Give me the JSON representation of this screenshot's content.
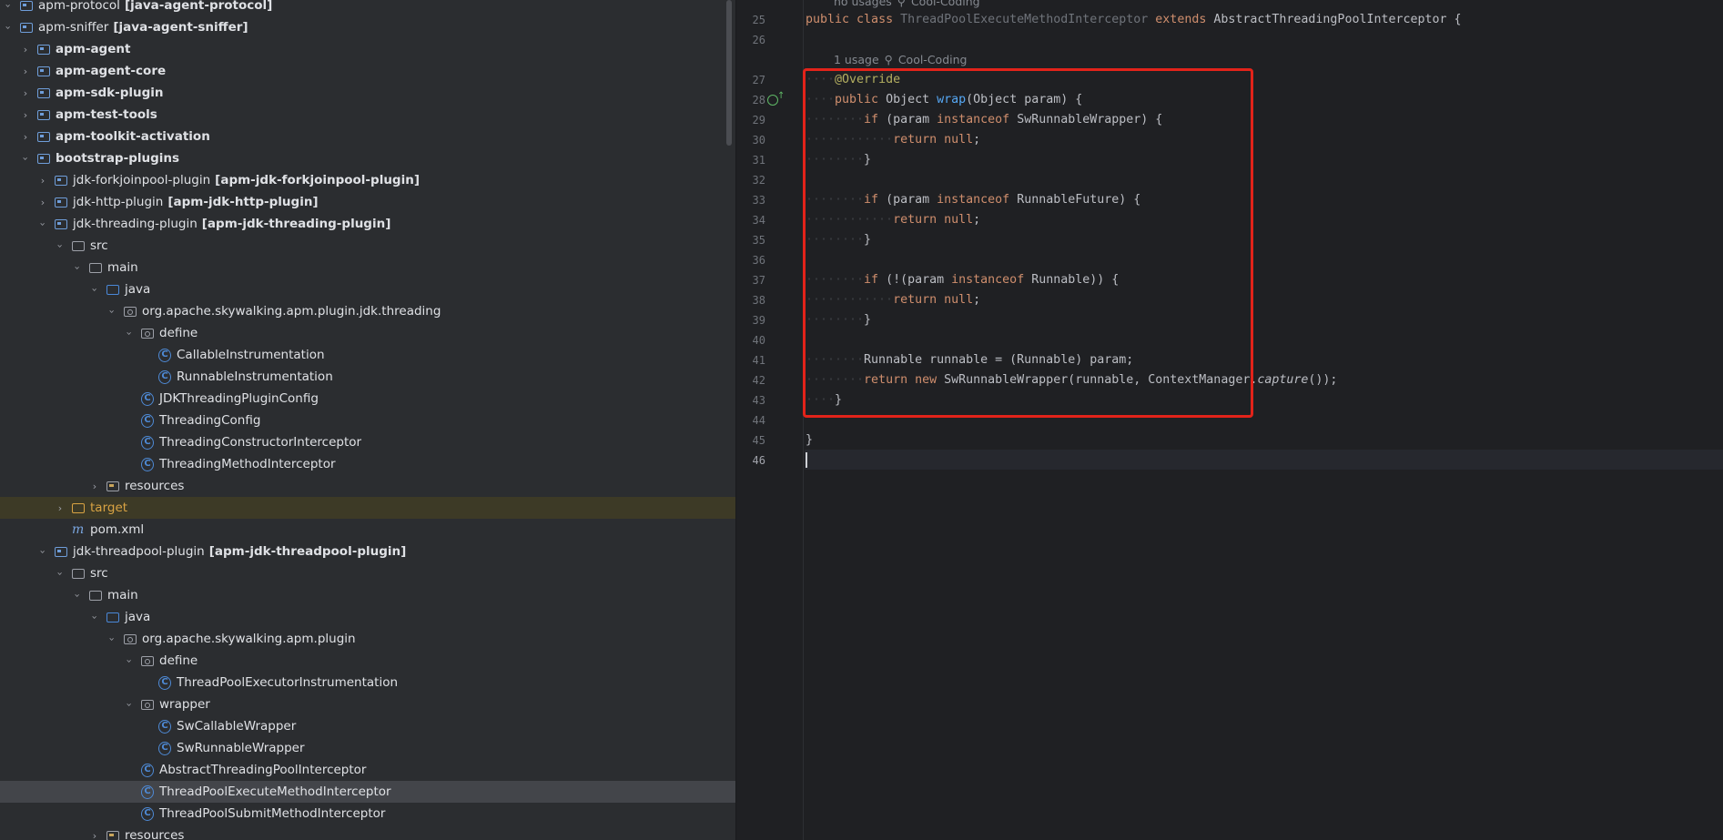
{
  "project_tree": {
    "items": [
      {
        "depth": 0,
        "chev": "open",
        "icon": "module",
        "label": "apm-protocol",
        "tag": "[java-agent-protocol]",
        "bold": false
      },
      {
        "depth": 0,
        "chev": "open",
        "icon": "module",
        "label": "apm-sniffer",
        "tag": "[java-agent-sniffer]",
        "bold": false
      },
      {
        "depth": 1,
        "chev": "closed",
        "icon": "module",
        "label": "apm-agent",
        "tag": "",
        "bold": true
      },
      {
        "depth": 1,
        "chev": "closed",
        "icon": "module",
        "label": "apm-agent-core",
        "tag": "",
        "bold": true
      },
      {
        "depth": 1,
        "chev": "closed",
        "icon": "module",
        "label": "apm-sdk-plugin",
        "tag": "",
        "bold": true
      },
      {
        "depth": 1,
        "chev": "closed",
        "icon": "module",
        "label": "apm-test-tools",
        "tag": "",
        "bold": true
      },
      {
        "depth": 1,
        "chev": "closed",
        "icon": "module",
        "label": "apm-toolkit-activation",
        "tag": "",
        "bold": true
      },
      {
        "depth": 1,
        "chev": "open",
        "icon": "module",
        "label": "bootstrap-plugins",
        "tag": "",
        "bold": true
      },
      {
        "depth": 2,
        "chev": "closed",
        "icon": "module",
        "label": "jdk-forkjoinpool-plugin",
        "tag": "[apm-jdk-forkjoinpool-plugin]",
        "bold": false
      },
      {
        "depth": 2,
        "chev": "closed",
        "icon": "module",
        "label": "jdk-http-plugin",
        "tag": "[apm-jdk-http-plugin]",
        "bold": false
      },
      {
        "depth": 2,
        "chev": "open",
        "icon": "module",
        "label": "jdk-threading-plugin",
        "tag": "[apm-jdk-threading-plugin]",
        "bold": false
      },
      {
        "depth": 3,
        "chev": "open",
        "icon": "folder",
        "label": "src",
        "tag": "",
        "bold": false
      },
      {
        "depth": 4,
        "chev": "open",
        "icon": "folder",
        "label": "main",
        "tag": "",
        "bold": false
      },
      {
        "depth": 5,
        "chev": "open",
        "icon": "src",
        "label": "java",
        "tag": "",
        "bold": false
      },
      {
        "depth": 6,
        "chev": "open",
        "icon": "pkg",
        "label": "org.apache.skywalking.apm.plugin.jdk.threading",
        "tag": "",
        "bold": false
      },
      {
        "depth": 7,
        "chev": "open",
        "icon": "pkg",
        "label": "define",
        "tag": "",
        "bold": false
      },
      {
        "depth": 8,
        "chev": "none",
        "icon": "cls",
        "label": "CallableInstrumentation",
        "tag": "",
        "bold": false
      },
      {
        "depth": 8,
        "chev": "none",
        "icon": "cls",
        "label": "RunnableInstrumentation",
        "tag": "",
        "bold": false
      },
      {
        "depth": 7,
        "chev": "none",
        "icon": "cls",
        "label": "JDKThreadingPluginConfig",
        "tag": "",
        "bold": false
      },
      {
        "depth": 7,
        "chev": "none",
        "icon": "cls",
        "label": "ThreadingConfig",
        "tag": "",
        "bold": false
      },
      {
        "depth": 7,
        "chev": "none",
        "icon": "cls",
        "label": "ThreadingConstructorInterceptor",
        "tag": "",
        "bold": false
      },
      {
        "depth": 7,
        "chev": "none",
        "icon": "cls",
        "label": "ThreadingMethodInterceptor",
        "tag": "",
        "bold": false
      },
      {
        "depth": 5,
        "chev": "closed",
        "icon": "res",
        "label": "resources",
        "tag": "",
        "bold": false
      },
      {
        "depth": 3,
        "chev": "closed",
        "icon": "target",
        "label": "target",
        "tag": "",
        "bold": false,
        "highlight": "target"
      },
      {
        "depth": 3,
        "chev": "none",
        "icon": "mvn",
        "label": "pom.xml",
        "tag": "",
        "bold": false
      },
      {
        "depth": 2,
        "chev": "open",
        "icon": "module",
        "label": "jdk-threadpool-plugin",
        "tag": "[apm-jdk-threadpool-plugin]",
        "bold": false
      },
      {
        "depth": 3,
        "chev": "open",
        "icon": "folder",
        "label": "src",
        "tag": "",
        "bold": false
      },
      {
        "depth": 4,
        "chev": "open",
        "icon": "folder",
        "label": "main",
        "tag": "",
        "bold": false
      },
      {
        "depth": 5,
        "chev": "open",
        "icon": "src",
        "label": "java",
        "tag": "",
        "bold": false
      },
      {
        "depth": 6,
        "chev": "open",
        "icon": "pkg",
        "label": "org.apache.skywalking.apm.plugin",
        "tag": "",
        "bold": false
      },
      {
        "depth": 7,
        "chev": "open",
        "icon": "pkg",
        "label": "define",
        "tag": "",
        "bold": false
      },
      {
        "depth": 8,
        "chev": "none",
        "icon": "cls",
        "label": "ThreadPoolExecutorInstrumentation",
        "tag": "",
        "bold": false
      },
      {
        "depth": 7,
        "chev": "open",
        "icon": "pkg",
        "label": "wrapper",
        "tag": "",
        "bold": false
      },
      {
        "depth": 8,
        "chev": "none",
        "icon": "cls",
        "label": "SwCallableWrapper",
        "tag": "",
        "bold": false
      },
      {
        "depth": 8,
        "chev": "none",
        "icon": "cls",
        "label": "SwRunnableWrapper",
        "tag": "",
        "bold": false
      },
      {
        "depth": 7,
        "chev": "none",
        "icon": "cls",
        "label": "AbstractThreadingPoolInterceptor",
        "tag": "",
        "bold": false
      },
      {
        "depth": 7,
        "chev": "none",
        "icon": "cls",
        "label": "ThreadPoolExecuteMethodInterceptor",
        "tag": "",
        "bold": false,
        "highlight": "selected"
      },
      {
        "depth": 7,
        "chev": "none",
        "icon": "cls",
        "label": "ThreadPoolSubmitMethodInterceptor",
        "tag": "",
        "bold": false
      },
      {
        "depth": 5,
        "chev": "closed",
        "icon": "res",
        "label": "resources",
        "tag": "",
        "bold": false
      }
    ]
  },
  "editor": {
    "hints": [
      {
        "usage": "no usages",
        "author": "Cool-Coding"
      },
      {
        "usage": "1 usage",
        "author": "Cool-Coding"
      }
    ],
    "lines": [
      {
        "n": "25",
        "segs": [
          [
            "kw",
            "public "
          ],
          [
            "kw",
            "class "
          ],
          [
            "muted",
            "ThreadPoolExecuteMethodInterceptor "
          ],
          [
            "kw",
            "extends "
          ],
          [
            "",
            "AbstractThreadingPoolInterceptor {"
          ]
        ]
      },
      {
        "n": "26",
        "segs": []
      },
      {
        "n": "27",
        "segs": [
          [
            "ws",
            "····"
          ],
          [
            "ann",
            "@Override"
          ]
        ]
      },
      {
        "n": "28",
        "segs": [
          [
            "ws",
            "····"
          ],
          [
            "kw",
            "public "
          ],
          [
            "",
            "Object "
          ],
          [
            "fn",
            "wrap"
          ],
          [
            "",
            "(Object param) {"
          ]
        ]
      },
      {
        "n": "29",
        "segs": [
          [
            "ws",
            "········"
          ],
          [
            "kw",
            "if "
          ],
          [
            "",
            "(param "
          ],
          [
            "kw",
            "instanceof "
          ],
          [
            "",
            "SwRunnableWrapper) {"
          ]
        ]
      },
      {
        "n": "30",
        "segs": [
          [
            "ws",
            "············"
          ],
          [
            "kw",
            "return null"
          ],
          [
            "",
            ";"
          ]
        ]
      },
      {
        "n": "31",
        "segs": [
          [
            "ws",
            "········"
          ],
          [
            "",
            "}"
          ]
        ]
      },
      {
        "n": "32",
        "segs": []
      },
      {
        "n": "33",
        "segs": [
          [
            "ws",
            "········"
          ],
          [
            "kw",
            "if "
          ],
          [
            "",
            "(param "
          ],
          [
            "kw",
            "instanceof "
          ],
          [
            "",
            "RunnableFuture) {"
          ]
        ]
      },
      {
        "n": "34",
        "segs": [
          [
            "ws",
            "············"
          ],
          [
            "kw",
            "return null"
          ],
          [
            "",
            ";"
          ]
        ]
      },
      {
        "n": "35",
        "segs": [
          [
            "ws",
            "········"
          ],
          [
            "",
            "}"
          ]
        ]
      },
      {
        "n": "36",
        "segs": []
      },
      {
        "n": "37",
        "segs": [
          [
            "ws",
            "········"
          ],
          [
            "kw",
            "if "
          ],
          [
            "",
            "(!(param "
          ],
          [
            "kw",
            "instanceof "
          ],
          [
            "",
            "Runnable)) {"
          ]
        ]
      },
      {
        "n": "38",
        "segs": [
          [
            "ws",
            "············"
          ],
          [
            "kw",
            "return null"
          ],
          [
            "",
            ";"
          ]
        ]
      },
      {
        "n": "39",
        "segs": [
          [
            "ws",
            "········"
          ],
          [
            "",
            "}"
          ]
        ]
      },
      {
        "n": "40",
        "segs": []
      },
      {
        "n": "41",
        "segs": [
          [
            "ws",
            "········"
          ],
          [
            "",
            "Runnable runnable = (Runnable) param;"
          ]
        ]
      },
      {
        "n": "42",
        "segs": [
          [
            "ws",
            "········"
          ],
          [
            "kw",
            "return new "
          ],
          [
            "",
            "SwRunnableWrapper(runnable, ContextManager."
          ],
          [
            "ital",
            "capture"
          ],
          [
            "",
            "());"
          ]
        ]
      },
      {
        "n": "43",
        "segs": [
          [
            "ws",
            "····"
          ],
          [
            "",
            "}"
          ]
        ]
      },
      {
        "n": "44",
        "segs": []
      },
      {
        "n": "45",
        "segs": [
          [
            "",
            "}"
          ]
        ]
      },
      {
        "n": "46",
        "segs": []
      }
    ],
    "current_line": "46"
  },
  "colors": {
    "highlight_box": "#e2231a",
    "keyword": "#cf8e6d",
    "annotation": "#b3ae60",
    "method": "#56a8f5"
  }
}
